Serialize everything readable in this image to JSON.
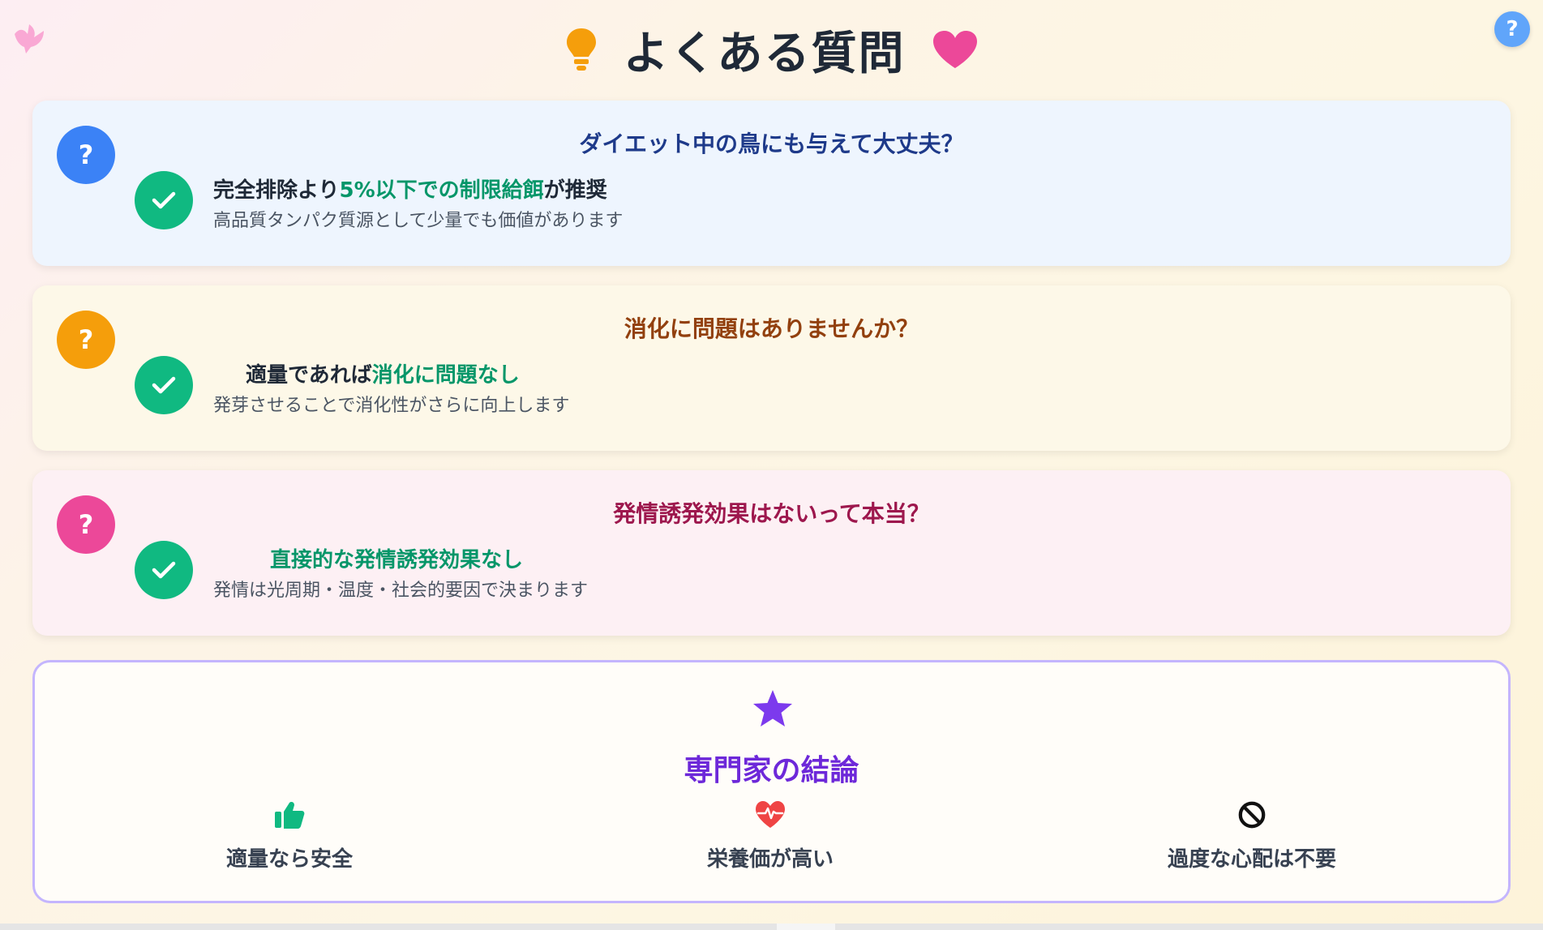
{
  "header": {
    "title": "よくある質問",
    "left_icon": "lightbulb-icon",
    "right_icon": "heart-icon"
  },
  "corner": {
    "bird_icon": "dove-icon",
    "help_label": "?"
  },
  "colors": {
    "blue": "#3b82f6",
    "yellow": "#f59e0b",
    "pink": "#ec4899",
    "green": "#10b981",
    "purple": "#6d28d9"
  },
  "faqs": [
    {
      "badge": "?",
      "question": "ダイエット中の鳥にも与えて大丈夫？",
      "answer_parts": [
        "完全排除より",
        "5%以下での制限給餌",
        "が推奨"
      ],
      "detail": "高品質タンパク質源として少量でも価値があります"
    },
    {
      "badge": "?",
      "question": "消化に問題はありませんか？",
      "answer_parts": [
        "適量であれば",
        "消化に問題なし"
      ],
      "detail": "発芽させることで消化性がさらに向上します"
    },
    {
      "badge": "?",
      "question": "発情誘発効果はないって本当？",
      "answer_parts": [
        "直接的な発情誘発効果なし"
      ],
      "detail": "発情は光周期・温度・社会的要因で決まります"
    }
  ],
  "conclusion": {
    "title": "専門家の結論",
    "icon": "star-icon",
    "items": [
      {
        "icon": "thumbs-up-icon",
        "label": "適量なら安全"
      },
      {
        "icon": "heartbeat-icon",
        "label": "栄養価が高い"
      },
      {
        "icon": "ban-icon",
        "label": "過度な心配は不要"
      }
    ]
  }
}
